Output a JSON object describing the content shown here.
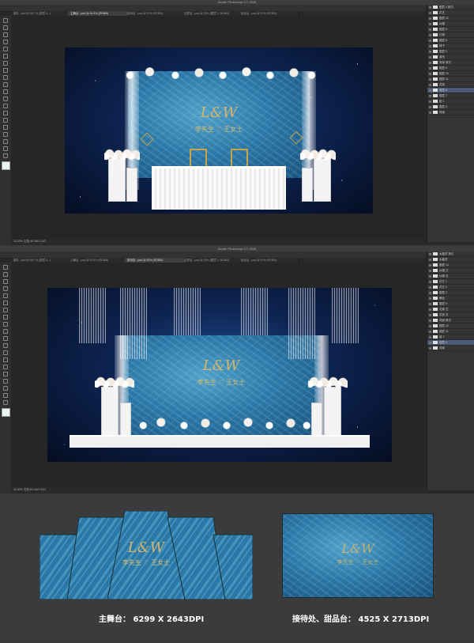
{
  "app": {
    "title": "Adobe Photoshop CC 2018"
  },
  "window1": {
    "options_label": "显示变换控件",
    "tabs": [
      "婚礼...psd @ 66.7% (图层 4...)",
      "主舞台...psd @ 33.3% (RGB/8)",
      "接待处...psd @ 50% (RGB/8)",
      "迎宾区...psd @ 25% (图层 1, RGB/8)",
      "甜品台...psd @ 50% (RGB/8)"
    ],
    "status": "33.33%   文档:45.2M/1.24G",
    "layers": [
      "图层 4 拷贝",
      "花艺",
      "图层 12",
      "纱幔",
      "图层 5",
      "灯架",
      "图层 8",
      "椅子",
      "图层 3",
      "桌布",
      "背景 拷贝",
      "图层 9",
      "图层 10",
      "图层 11",
      "花架",
      "图层 6",
      "图层 7",
      "组 1",
      "图层 2",
      "背景"
    ]
  },
  "window2": {
    "options_label": "显示变换控件",
    "tabs": [
      "婚礼...psd @ 66.7% (图层 4...)",
      "主舞台...psd @ 33.3% (RGB/8)",
      "接待处...psd @ 50% (RGB/8)",
      "迎宾区...psd @ 25% (图层 1, RGB/8)",
      "甜品台...psd @ 50% (RGB/8)"
    ],
    "status": "33.33%   文档:60.1M/1.52G",
    "layers": [
      "水晶帘 拷贝",
      "水晶帘",
      "图层 14",
      "纱幔 左",
      "纱幔 右",
      "花艺 1",
      "花艺 2",
      "图层 3",
      "舞台",
      "图层 9",
      "花架 左",
      "花架 右",
      "背景 拷贝",
      "图层 10",
      "图层 11",
      "组 2",
      "图层 5",
      "背景"
    ]
  },
  "design": {
    "monogram": "L&W",
    "names": "李先生 ♡ 王女士"
  },
  "captions": {
    "main_stage": "主舞台：  6299 X 2643DPI",
    "reception": "接待处、甜品台：  4525 X 2713DPI"
  },
  "colors": {
    "accent": "#d6b66a",
    "feather_blue": "#2a78a8",
    "night": "#0d2350"
  }
}
